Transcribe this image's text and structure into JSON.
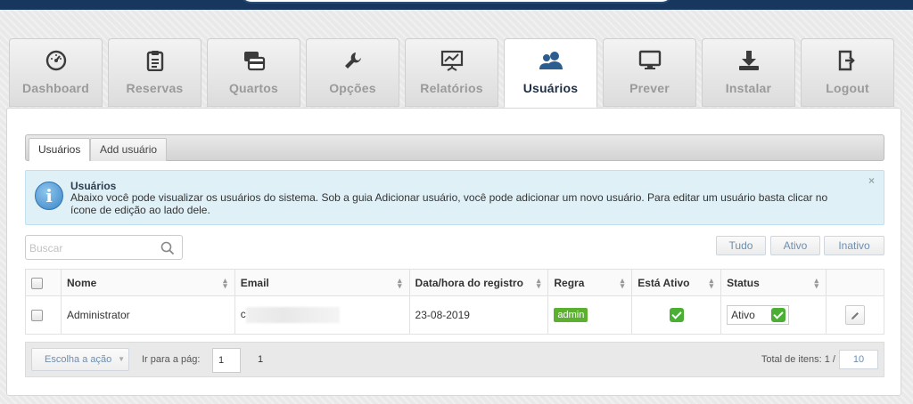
{
  "nav_tabs": [
    {
      "label": "Dashboard",
      "icon": "dashboard-icon",
      "active": false
    },
    {
      "label": "Reservas",
      "icon": "clipboard-icon",
      "active": false
    },
    {
      "label": "Quartos",
      "icon": "cards-icon",
      "active": false
    },
    {
      "label": "Opções",
      "icon": "wrench-icon",
      "active": false
    },
    {
      "label": "Relatórios",
      "icon": "presentation-chart-icon",
      "active": false
    },
    {
      "label": "Usuários",
      "icon": "users-icon",
      "active": true
    },
    {
      "label": "Prever",
      "icon": "monitor-icon",
      "active": false
    },
    {
      "label": "Instalar",
      "icon": "download-icon",
      "active": false
    },
    {
      "label": "Logout",
      "icon": "logout-icon",
      "active": false
    }
  ],
  "sub_tabs": [
    {
      "label": "Usuários",
      "active": true
    },
    {
      "label": "Add usuário",
      "active": false
    }
  ],
  "alert": {
    "title": "Usuários",
    "text": "Abaixo você pode visualizar os usuários do sistema. Sob a guia Adicionar usuário, você pode adicionar um novo usuário. Para editar um usuário basta clicar no ícone de edição ao lado dele.",
    "close": "×"
  },
  "search": {
    "placeholder": "Buscar",
    "value": ""
  },
  "filters": {
    "all": "Tudo",
    "active": "Ativo",
    "inactive": "Inativo"
  },
  "table": {
    "headers": {
      "name": "Nome",
      "email": "Email",
      "registered": "Data/hora do registro",
      "role": "Regra",
      "is_active": "Está Ativo",
      "status": "Status"
    },
    "rows": [
      {
        "name": "Administrator",
        "email": "c",
        "registered": "23-08-2019",
        "role": "admin",
        "is_active": true,
        "status": "Ativo"
      }
    ]
  },
  "footer": {
    "action_label": "Escolha a ação",
    "goto_label": "Ir para a pág:",
    "page_value": "1",
    "pages": "1",
    "total_label": "Total de itens: 1 /",
    "per_page": "10"
  },
  "colors": {
    "topbar": "#18375f",
    "active_tab_text": "#1f2f45",
    "admin_badge": "#5cb02f",
    "alert_bg": "#dff0f7"
  }
}
